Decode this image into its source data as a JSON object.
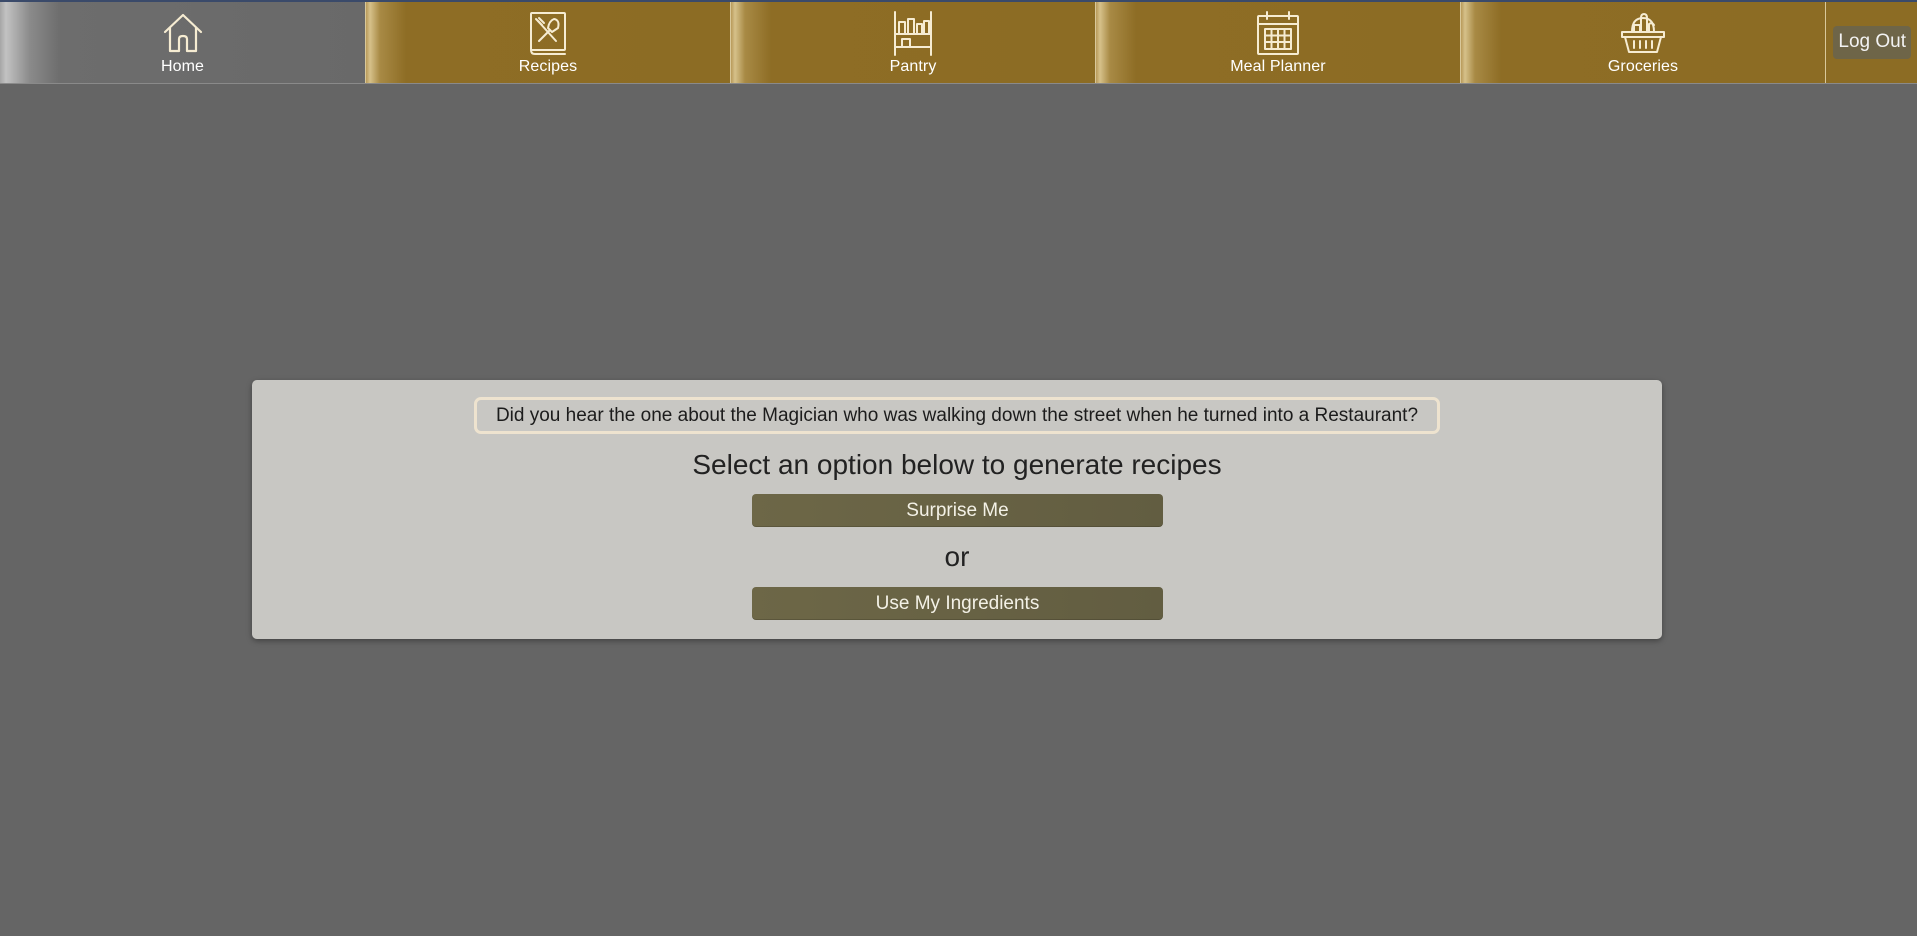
{
  "nav": {
    "items": [
      {
        "label": "Home",
        "icon": "home-icon"
      },
      {
        "label": "Recipes",
        "icon": "recipe-book-icon"
      },
      {
        "label": "Pantry",
        "icon": "pantry-shelf-icon"
      },
      {
        "label": "Meal Planner",
        "icon": "calendar-icon"
      },
      {
        "label": "Groceries",
        "icon": "grocery-basket-icon"
      }
    ],
    "logout_label": "Log Out"
  },
  "main": {
    "joke": "Did you hear the one about the Magician who was walking down the street when he turned into a Restaurant?",
    "prompt": "Select an option below to generate recipes",
    "surprise_label": "Surprise Me",
    "or_label": "or",
    "ingredients_label": "Use My Ingredients"
  },
  "colors": {
    "background": "#656565",
    "nav_gold": "#8c6c24",
    "card": "#c8c7c3",
    "button": "#6d6747",
    "icon_stroke": "#f6ecd2"
  }
}
